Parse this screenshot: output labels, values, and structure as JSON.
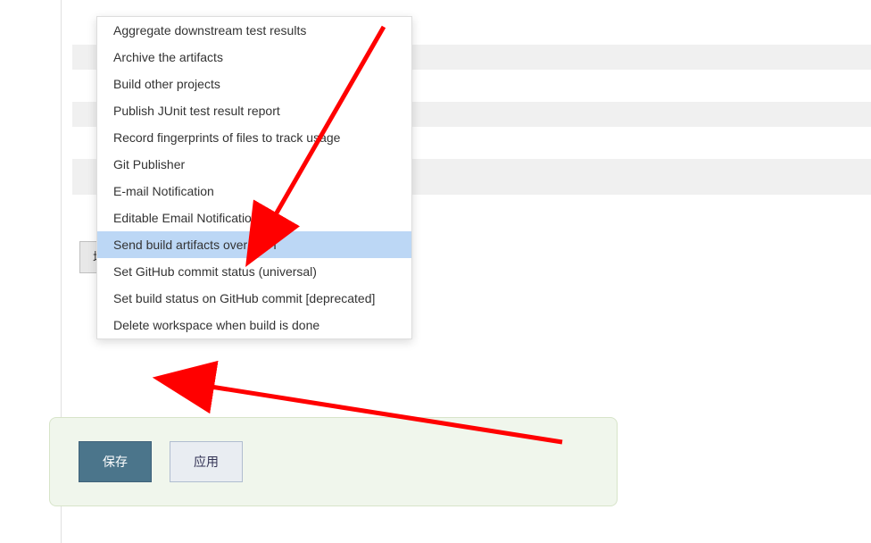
{
  "dropdown": {
    "items": [
      {
        "label": "Aggregate downstream test results",
        "highlighted": false
      },
      {
        "label": "Archive the artifacts",
        "highlighted": false
      },
      {
        "label": "Build other projects",
        "highlighted": false
      },
      {
        "label": "Publish JUnit test result report",
        "highlighted": false
      },
      {
        "label": "Record fingerprints of files to track usage",
        "highlighted": false
      },
      {
        "label": "Git Publisher",
        "highlighted": false
      },
      {
        "label": "E-mail Notification",
        "highlighted": false
      },
      {
        "label": "Editable Email Notification",
        "highlighted": false
      },
      {
        "label": "Send build artifacts over SSH",
        "highlighted": true
      },
      {
        "label": "Set GitHub commit status (universal)",
        "highlighted": false
      },
      {
        "label": "Set build status on GitHub commit [deprecated]",
        "highlighted": false
      },
      {
        "label": "Delete workspace when build is done",
        "highlighted": false
      }
    ]
  },
  "buttons": {
    "add_step": "增加构建后操作步骤",
    "save": "保存",
    "apply": "应用"
  },
  "annotation": {
    "arrow_color": "#ff0000"
  }
}
